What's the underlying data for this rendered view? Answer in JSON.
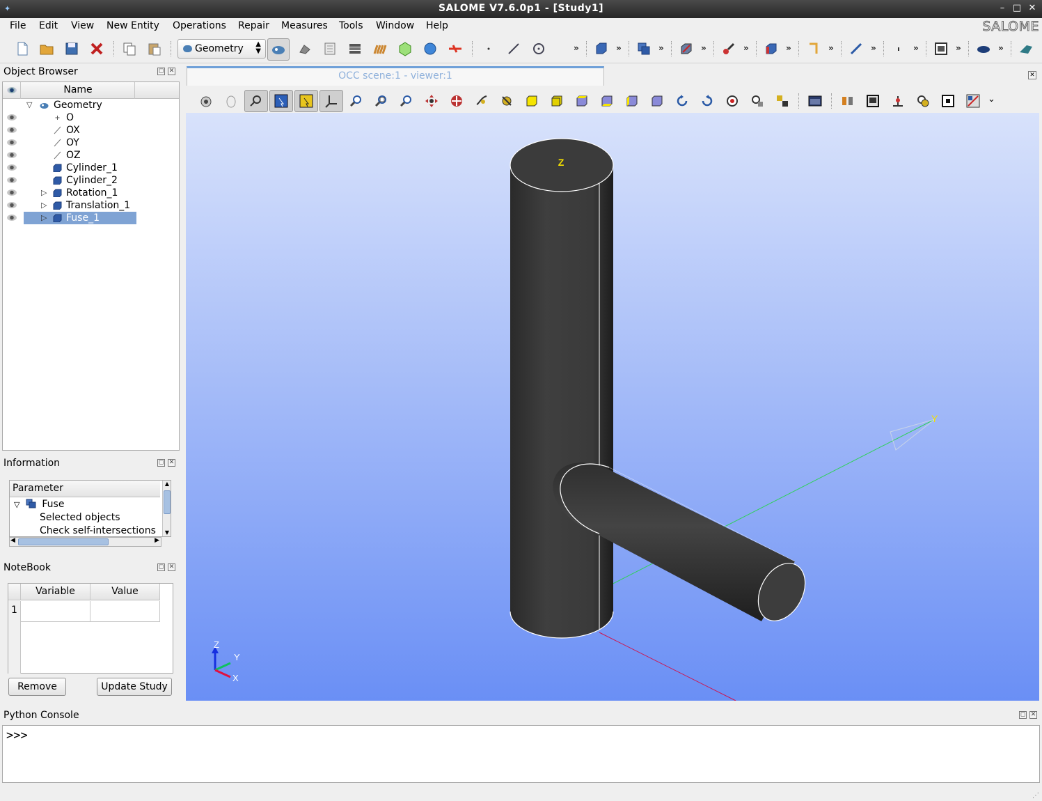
{
  "window": {
    "title": "SALOME  V7.6.0p1 - [Study1]"
  },
  "menu": {
    "items": [
      "File",
      "Edit",
      "View",
      "New Entity",
      "Operations",
      "Repair",
      "Measures",
      "Tools",
      "Window",
      "Help"
    ],
    "brand": "SALOME"
  },
  "toolbar": {
    "module": "Geometry",
    "more_label": "»"
  },
  "object_browser": {
    "title": "Object Browser",
    "column_name": "Name",
    "root": "Geometry",
    "items": [
      {
        "label": "O",
        "icon": "point-icon"
      },
      {
        "label": "OX",
        "icon": "vector-icon"
      },
      {
        "label": "OY",
        "icon": "vector-icon"
      },
      {
        "label": "OZ",
        "icon": "vector-icon"
      },
      {
        "label": "Cylinder_1",
        "icon": "solid-icon"
      },
      {
        "label": "Cylinder_2",
        "icon": "solid-icon"
      },
      {
        "label": "Rotation_1",
        "icon": "solid-icon",
        "expandable": true
      },
      {
        "label": "Translation_1",
        "icon": "solid-icon",
        "expandable": true
      },
      {
        "label": "Fuse_1",
        "icon": "solid-icon",
        "expandable": true,
        "selected": true
      }
    ]
  },
  "information": {
    "title": "Information",
    "column": "Parameter",
    "rows": [
      "Fuse",
      "Selected objects",
      "Check self-intersections"
    ]
  },
  "notebook": {
    "title": "NoteBook",
    "columns": [
      "Variable",
      "Value"
    ],
    "row_number": "1",
    "remove_label": "Remove",
    "update_label": "Update Study"
  },
  "viewer": {
    "tab_label": "OCC scene:1 - viewer:1",
    "axis_labels": {
      "z": "Z",
      "y": "Y",
      "x": "X"
    },
    "triedron_labels": {
      "z": "Z",
      "y": "Y",
      "x": "X"
    }
  },
  "python_console": {
    "title": "Python Console",
    "prompt": ">>>"
  },
  "colors": {
    "viewport_top": "#d8e2fb",
    "viewport_bottom": "#6a8ff5",
    "selection": "#7fa3d4",
    "solid": "#3c3c3c"
  }
}
